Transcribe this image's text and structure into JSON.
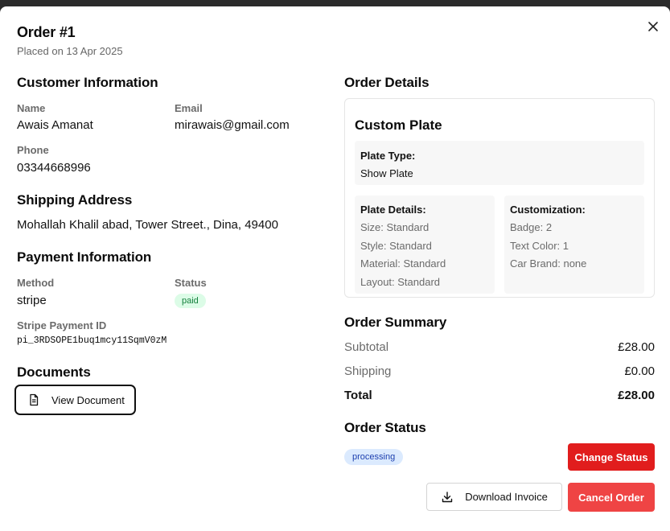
{
  "header": {
    "title": "Order #1",
    "subtitle": "Placed on 13 Apr 2025",
    "close_icon": "close-icon"
  },
  "customer": {
    "heading": "Customer Information",
    "name_label": "Name",
    "name_value": "Awais Amanat",
    "email_label": "Email",
    "email_value": "mirawais@gmail.com",
    "phone_label": "Phone",
    "phone_value": "03344668996"
  },
  "shipping": {
    "heading": "Shipping Address",
    "address": "Mohallah Khalil abad, Tower Street., Dina, 49400"
  },
  "payment": {
    "heading": "Payment Information",
    "method_label": "Method",
    "method_value": "stripe",
    "status_label": "Status",
    "status_value": "paid",
    "stripe_id_label": "Stripe Payment ID",
    "stripe_id_value": "pi_3RDSOPE1buq1mcy11SqmV0zM"
  },
  "documents": {
    "heading": "Documents",
    "view_button": "View Document",
    "icon": "document-icon"
  },
  "order_details": {
    "heading": "Order Details",
    "product_title": "Custom Plate",
    "plate_type_label": "Plate Type:",
    "plate_type_value": "Show Plate",
    "plate_details_label": "Plate Details:",
    "plate_details": [
      "Size: Standard",
      "Style: Standard",
      "Material: Standard",
      "Layout: Standard"
    ],
    "customization_label": "Customization:",
    "customization": [
      "Badge: 2",
      "Text Color: 1",
      "Car Brand: none"
    ]
  },
  "summary": {
    "heading": "Order Summary",
    "subtotal_label": "Subtotal",
    "subtotal_value": "£28.00",
    "shipping_label": "Shipping",
    "shipping_value": "£0.00",
    "total_label": "Total",
    "total_value": "£28.00"
  },
  "order_status": {
    "heading": "Order Status",
    "status_value": "processing",
    "change_button": "Change Status"
  },
  "actions": {
    "download_button": "Download Invoice",
    "download_icon": "download-icon",
    "cancel_button": "Cancel Order"
  },
  "colors": {
    "danger": "#e11d1d",
    "danger_light": "#ef4444",
    "paid_bg": "#dcfce7",
    "paid_fg": "#15803d",
    "processing_bg": "#dbeafe",
    "processing_fg": "#1e40af"
  }
}
